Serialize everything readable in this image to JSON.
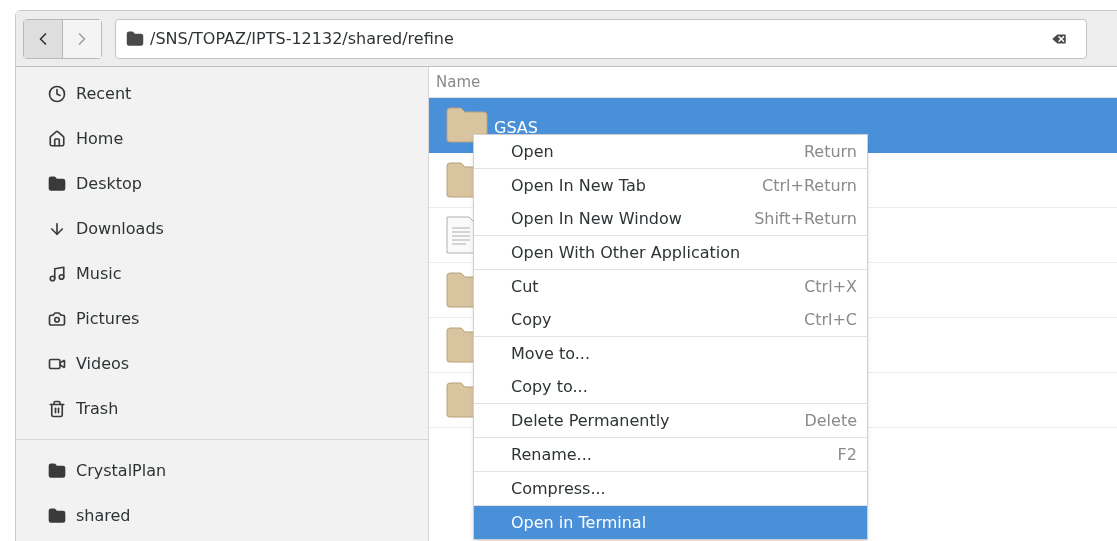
{
  "toolbar": {
    "back": {
      "disabled": false
    },
    "forward": {
      "disabled": true
    },
    "path": "/SNS/TOPAZ/IPTS-12132/shared/refine"
  },
  "sidebar": {
    "places": [
      {
        "label": "Recent",
        "kind": "recent"
      },
      {
        "label": "Home",
        "kind": "home"
      },
      {
        "label": "Desktop",
        "kind": "desktop"
      },
      {
        "label": "Downloads",
        "kind": "downloads"
      },
      {
        "label": "Music",
        "kind": "music"
      },
      {
        "label": "Pictures",
        "kind": "pictures"
      },
      {
        "label": "Videos",
        "kind": "videos"
      },
      {
        "label": "Trash",
        "kind": "trash"
      }
    ],
    "bookmarks": [
      {
        "label": "CrystalPlan",
        "kind": "folder"
      },
      {
        "label": "shared",
        "kind": "folder"
      }
    ]
  },
  "file_list": {
    "column": "Name",
    "rows": [
      {
        "name": "GSAS",
        "kind": "folder",
        "selected": true
      },
      {
        "kind": "folder",
        "selected": false
      },
      {
        "kind": "document",
        "selected": false
      },
      {
        "kind": "folder",
        "selected": false
      },
      {
        "kind": "folder",
        "selected": false
      },
      {
        "kind": "folder",
        "selected": false
      }
    ]
  },
  "context_menu": {
    "groups": [
      [
        {
          "label": "Open",
          "shortcut": "Return",
          "highlighted": false
        }
      ],
      [
        {
          "label": "Open In New Tab",
          "shortcut": "Ctrl+Return",
          "highlighted": false
        },
        {
          "label": "Open In New Window",
          "shortcut": "Shift+Return",
          "highlighted": false
        }
      ],
      [
        {
          "label": "Open With Other Application",
          "highlighted": false
        }
      ],
      [
        {
          "label": "Cut",
          "shortcut": "Ctrl+X",
          "highlighted": false
        },
        {
          "label": "Copy",
          "shortcut": "Ctrl+C",
          "highlighted": false
        }
      ],
      [
        {
          "label": "Move to...",
          "highlighted": false
        },
        {
          "label": "Copy to...",
          "highlighted": false
        }
      ],
      [
        {
          "label": "Delete Permanently",
          "shortcut": "Delete",
          "highlighted": false
        }
      ],
      [
        {
          "label": "Rename...",
          "shortcut": "F2",
          "highlighted": false
        }
      ],
      [
        {
          "label": "Compress...",
          "highlighted": false
        }
      ],
      [
        {
          "label": "Open in Terminal",
          "highlighted": true
        }
      ]
    ]
  }
}
